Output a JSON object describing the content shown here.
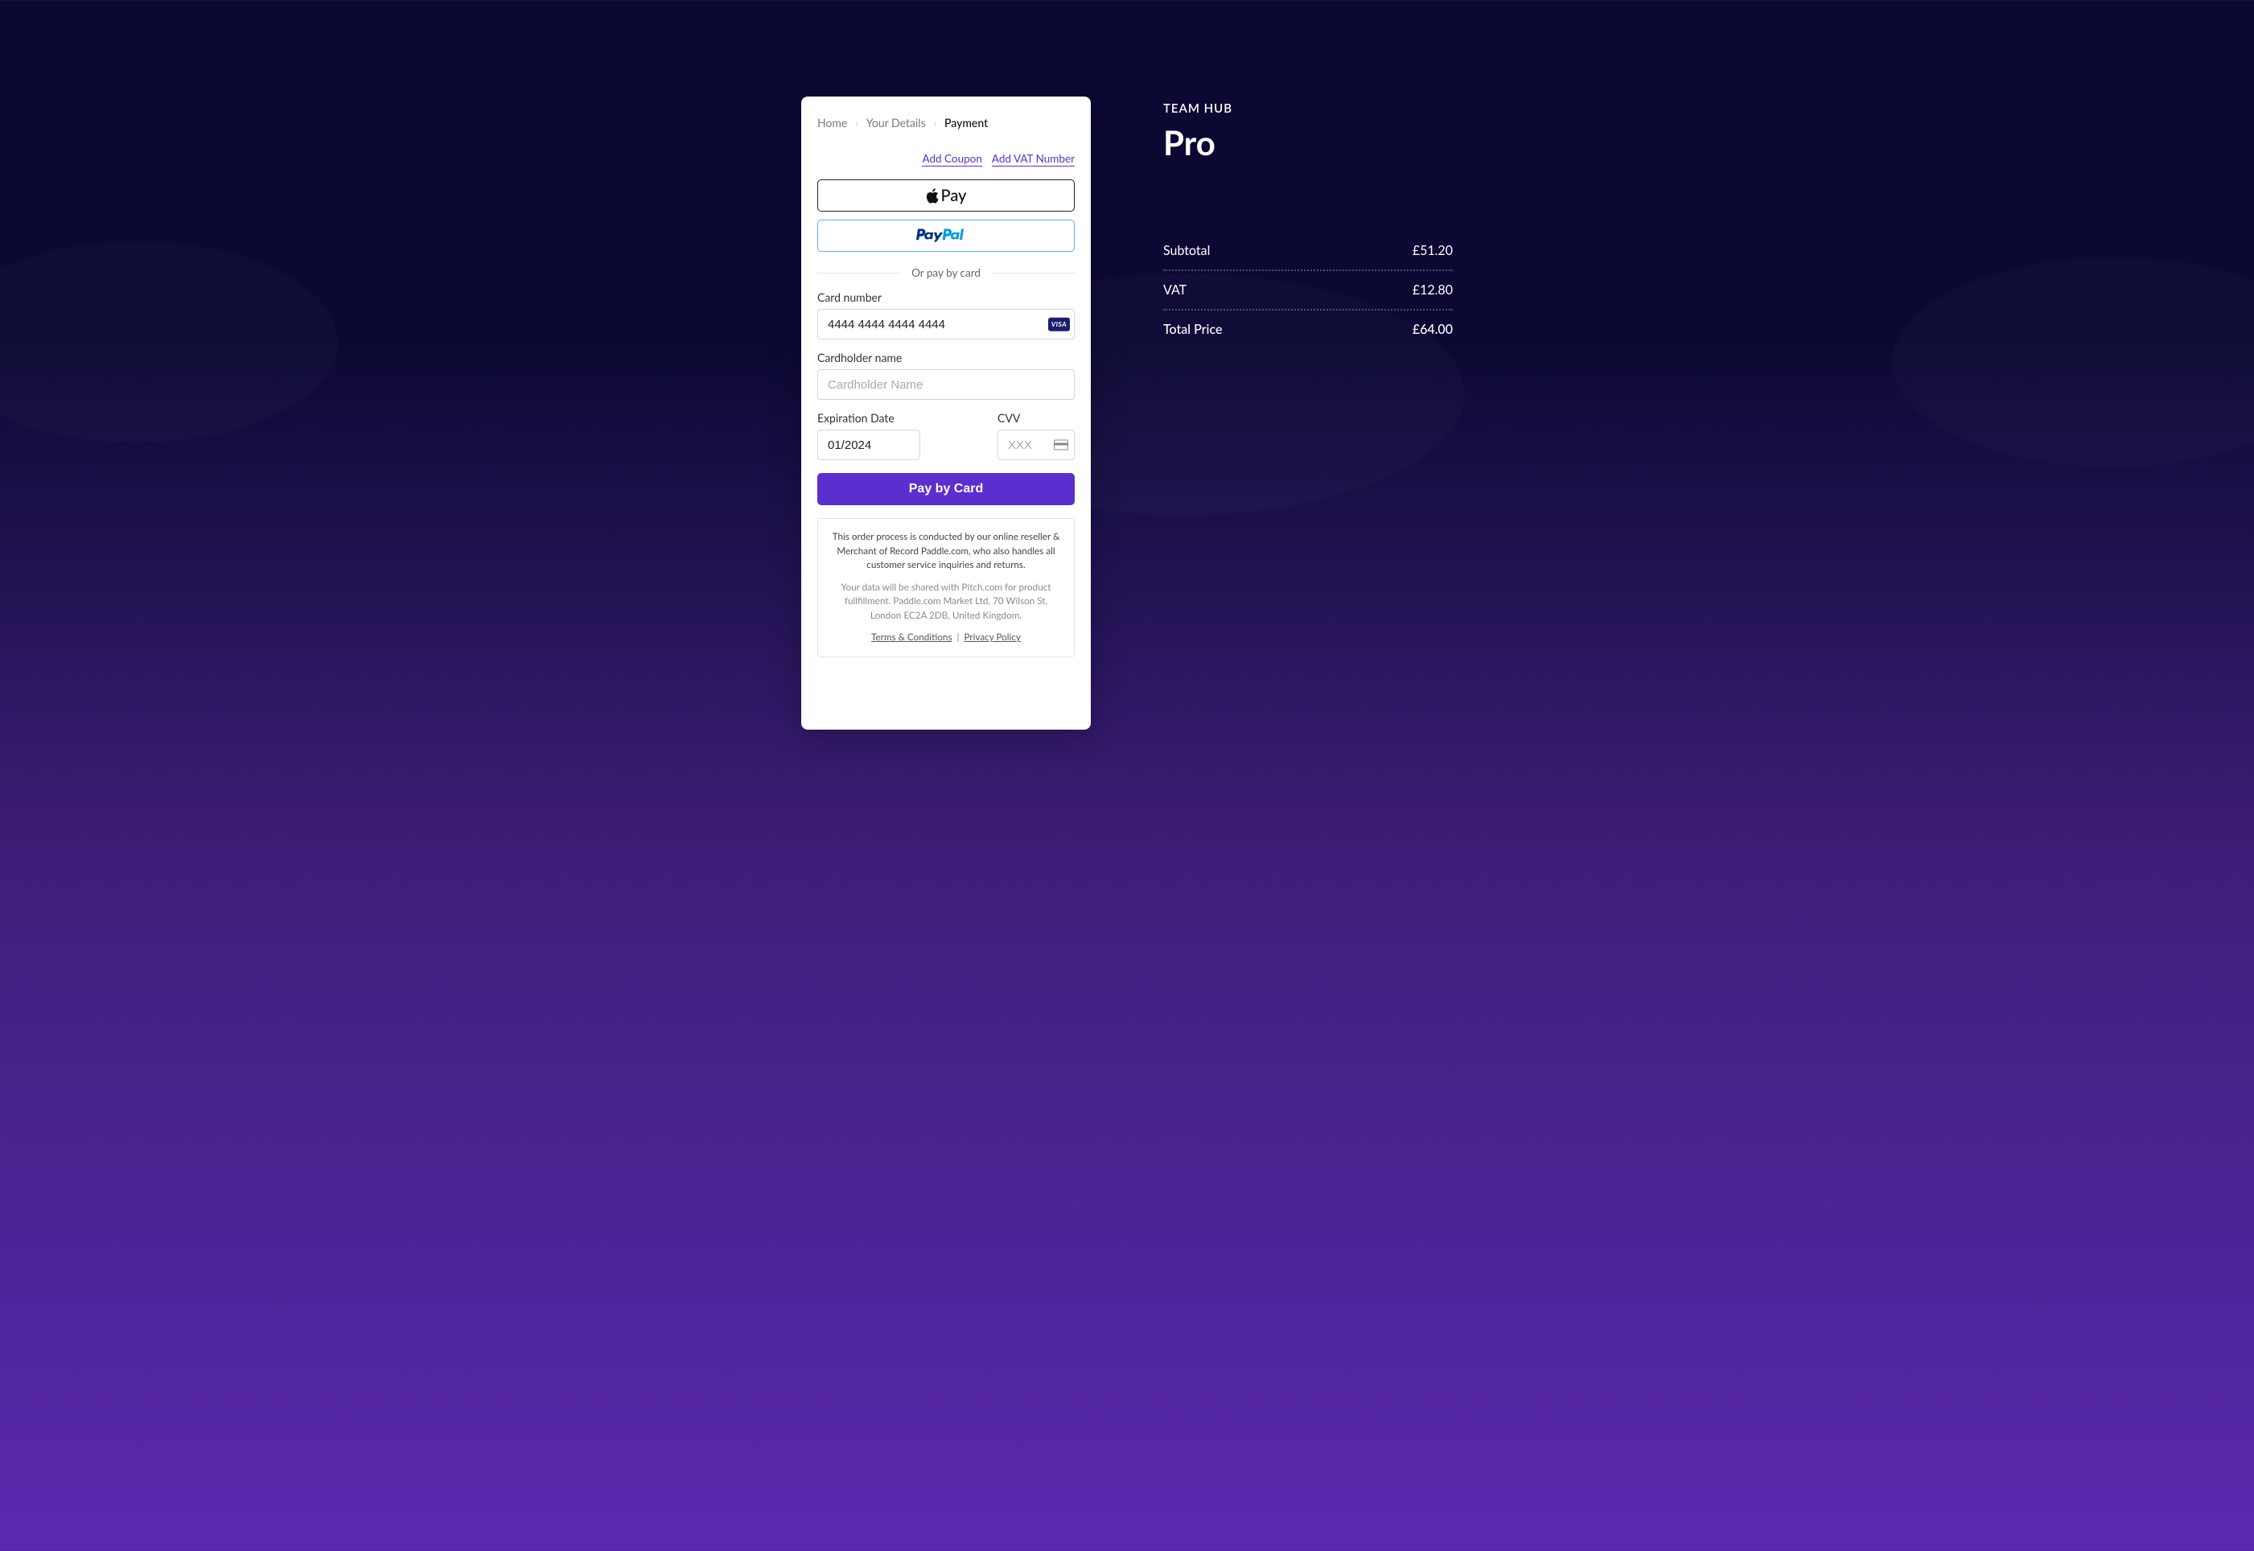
{
  "breadcrumb": {
    "home": "Home",
    "details": "Your Details",
    "payment": "Payment"
  },
  "links": {
    "add_coupon": "Add Coupon",
    "add_vat": "Add VAT Number"
  },
  "apple_pay_prefix": "",
  "apple_pay_text": "Pay",
  "divider_text": "Or pay by card",
  "fields": {
    "card_number_label": "Card number",
    "card_number_value": "4444 4444 4444 4444",
    "card_brand": "VISA",
    "cardholder_label": "Cardholder name",
    "cardholder_placeholder": "Cardholder Name",
    "expiration_label": "Expiration Date",
    "expiration_value": "01/2024",
    "cvv_label": "CVV",
    "cvv_placeholder": "XXX"
  },
  "submit_label": "Pay by Card",
  "legal": {
    "p1": "This order process is conducted by our online reseller & Merchant of Record Paddle.com, who also handles all customer service inquiries and returns.",
    "p2": "Your data will be shared with Pitch.com for product fullfillment. Paddle.com Market Ltd, 70  Wilson St, London EC2A 2DB, United Kingdom.",
    "terms": "Terms & Conditions",
    "sep": "|",
    "privacy": "Privacy Policy"
  },
  "summary": {
    "eyebrow": "TEAM HUB",
    "plan": "Pro",
    "subtotal_label": "Subtotal",
    "subtotal_value": "£51.20",
    "vat_label": "VAT",
    "vat_value": "£12.80",
    "total_label": "Total Price",
    "total_value": "£64.00"
  }
}
